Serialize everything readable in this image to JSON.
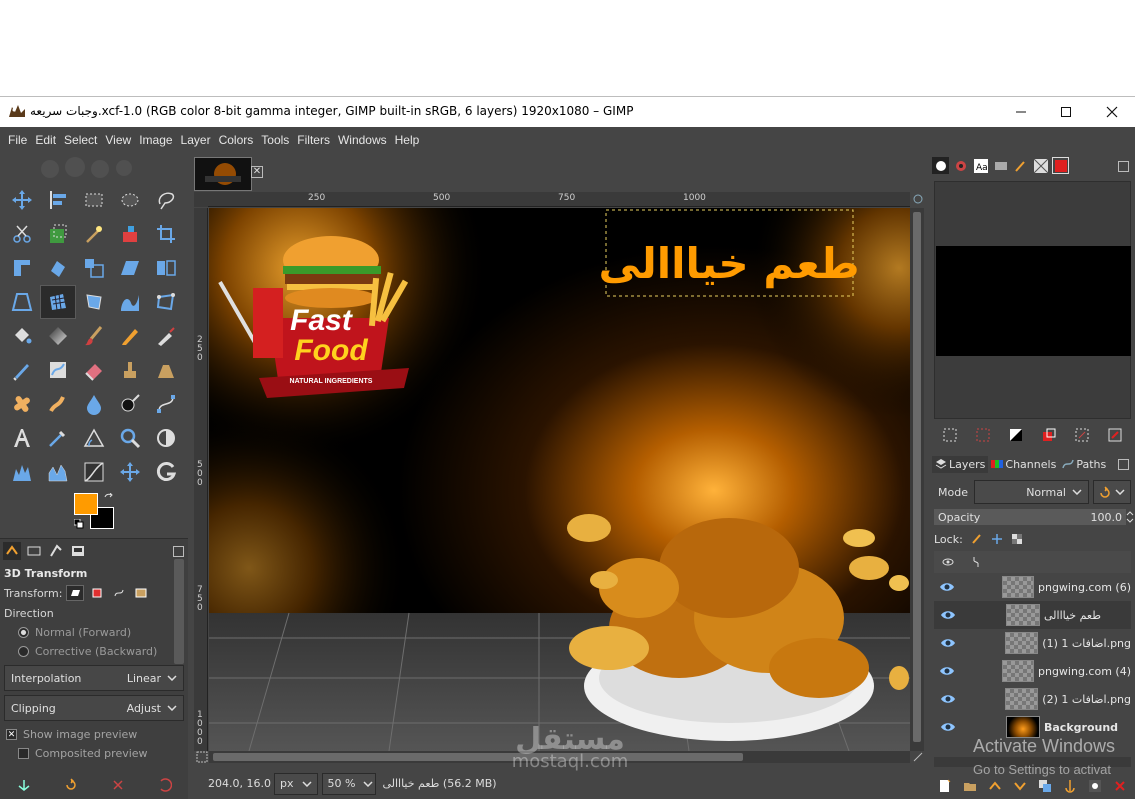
{
  "window": {
    "title": "وجبات سريعه.xcf-1.0 (RGB color 8-bit gamma integer, GIMP built-in sRGB, 6 layers) 1920x1080 – GIMP",
    "minimize": "—",
    "maximize": "☐",
    "close": "✕"
  },
  "menu": [
    "File",
    "Edit",
    "Select",
    "View",
    "Image",
    "Layer",
    "Colors",
    "Tools",
    "Filters",
    "Windows",
    "Help"
  ],
  "colors": {
    "foreground": "#ff9b00",
    "background": "#000000",
    "accent_orange": "#ff9b00",
    "dark_panel": "#454545"
  },
  "tool_options": {
    "title": "3D Transform",
    "transform_label": "Transform:",
    "direction_label": "Direction",
    "direction_options": [
      "Normal (Forward)",
      "Corrective (Backward)"
    ],
    "interpolation_label": "Interpolation",
    "interpolation_value": "Linear",
    "clipping_label": "Clipping",
    "clipping_value": "Adjust",
    "show_preview": "Show image preview",
    "composited_preview": "Composited preview"
  },
  "rulers": {
    "h_labels": [
      "250",
      "500",
      "750",
      "1000"
    ],
    "v_labels": [
      "2\n5\n0",
      "5\n0\n0",
      "7\n5\n0",
      "1\n0\n0\n0"
    ]
  },
  "canvas": {
    "headline": "طعم خيااالى",
    "logo_line1": "Fast",
    "logo_line2": "Food",
    "logo_ribbon": "NATURAL INGREDIENTS"
  },
  "status": {
    "coords": "204.0, 16.0",
    "unit": "px",
    "zoom": "50 %",
    "message": "طعم خيااالى (56.2 MB)"
  },
  "layers_panel": {
    "tabs": [
      "Layers",
      "Channels",
      "Paths"
    ],
    "mode_label": "Mode",
    "mode_value": "Normal",
    "opacity_label": "Opacity",
    "opacity_value": "100.0",
    "lock_label": "Lock:",
    "layers": [
      {
        "name": "pngwing.com (6)",
        "bold": false,
        "selected": false
      },
      {
        "name": "طعم خيااالى",
        "bold": false,
        "selected": true
      },
      {
        "name": "اضافات 1 (1).png",
        "bold": false,
        "selected": false
      },
      {
        "name": "pngwing.com (4)",
        "bold": false,
        "selected": false
      },
      {
        "name": "اضافات 1 (2).png",
        "bold": false,
        "selected": false
      },
      {
        "name": "Background",
        "bold": true,
        "selected": false
      }
    ]
  },
  "overlays": {
    "activate_title": "Activate Windows",
    "activate_sub": "Go to Settings to activat",
    "mostaql_ar": "مستقل",
    "mostaql_en": "mostaql.com"
  }
}
